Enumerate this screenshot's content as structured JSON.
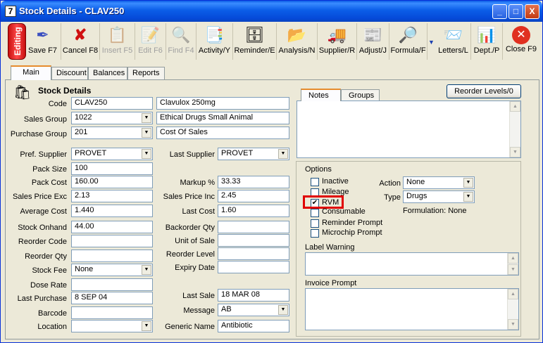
{
  "window": {
    "app_number": "7",
    "title": "Stock Details - CLAV250",
    "min": "_",
    "max": "□",
    "close": "X"
  },
  "toolbar": {
    "editing": "Editing",
    "buttons": [
      {
        "label": "Save F7",
        "icon": "pen-icon"
      },
      {
        "label": "Cancel F8",
        "icon": "cancel-x-icon"
      },
      {
        "label": "Insert F5",
        "icon": "insert-icon",
        "disabled": true
      },
      {
        "label": "Edit F6",
        "icon": "edit-icon",
        "disabled": true
      },
      {
        "label": "Find F4",
        "icon": "find-icon",
        "disabled": true
      },
      {
        "label": "Activity/Y",
        "icon": "activity-icon"
      },
      {
        "label": "Reminder/E",
        "icon": "reminder-icon"
      },
      {
        "label": "Analysis/N",
        "icon": "analysis-icon"
      },
      {
        "label": "Supplier/R",
        "icon": "truck-icon"
      },
      {
        "label": "Adjust/J",
        "icon": "adjust-icon"
      },
      {
        "label": "Formula/F",
        "icon": "formula-icon"
      },
      {
        "label": "Letters/L",
        "icon": "letters-icon"
      },
      {
        "label": "Dept./P",
        "icon": "dept-icon"
      },
      {
        "label": "Close F9",
        "icon": "close-circle-icon"
      }
    ]
  },
  "tabs": [
    "Main",
    "Discount",
    "Balances",
    "Reports"
  ],
  "stock": {
    "section_title": "Stock Details",
    "code_label": "Code",
    "code": "CLAV250",
    "description": "Clavulox 250mg",
    "sales_group_label": "Sales Group",
    "sales_group": "1022",
    "sales_group_desc": "Ethical Drugs Small Animal",
    "purchase_group_label": "Purchase Group",
    "purchase_group": "201",
    "purchase_group_desc": "Cost Of Sales",
    "pref_supplier_label": "Pref. Supplier",
    "pref_supplier": "PROVET",
    "last_supplier_label": "Last Supplier",
    "last_supplier": "PROVET",
    "pack_size_label": "Pack Size",
    "pack_size": "100",
    "pack_cost_label": "Pack Cost",
    "pack_cost": "160.00",
    "markup_label": "Markup %",
    "markup": "33.33",
    "sales_price_exc_label": "Sales Price Exc",
    "sales_price_exc": "2.13",
    "sales_price_inc_label": "Sales Price Inc",
    "sales_price_inc": "2.45",
    "average_cost_label": "Average Cost",
    "average_cost": "1.440",
    "last_cost_label": "Last Cost",
    "last_cost": "1.60",
    "stock_onhand_label": "Stock Onhand",
    "stock_onhand": "44.00",
    "backorder_qty_label": "Backorder Qty",
    "backorder_qty": "",
    "reorder_code_label": "Reorder Code",
    "reorder_code": "",
    "unit_of_sale_label": "Unit of Sale",
    "unit_of_sale": "",
    "reorder_qty_label": "Reorder Qty",
    "reorder_qty": "",
    "reorder_level_label": "Reorder Level",
    "reorder_level": "",
    "stock_fee_label": "Stock Fee",
    "stock_fee": "None",
    "expiry_date_label": "Expiry Date",
    "expiry_date": "",
    "dose_rate_label": "Dose Rate",
    "dose_rate": "",
    "last_purchase_label": "Last Purchase",
    "last_purchase": "8 SEP 04",
    "last_sale_label": "Last Sale",
    "last_sale": "18 MAR 08",
    "barcode_label": "Barcode",
    "barcode": "",
    "message_label": "Message",
    "message": "AB",
    "location_label": "Location",
    "location": "",
    "generic_name_label": "Generic Name",
    "generic_name": "Antibiotic"
  },
  "right": {
    "notes_tab": "Notes",
    "groups_tab": "Groups",
    "reorder_button": "Reorder Levels/0",
    "options_title": "Options",
    "inactive": "Inactive",
    "mileage": "Mileage",
    "rvm": "RVM",
    "consumable": "Consumable",
    "reminder_prompt": "Reminder Prompt",
    "microchip_prompt": "Microchip Prompt",
    "action_label": "Action",
    "action": "None",
    "type_label": "Type",
    "type": "Drugs",
    "formulation_label": "Formulation:",
    "formulation": "None",
    "label_warning": "Label Warning",
    "invoice_prompt": "Invoice Prompt"
  }
}
